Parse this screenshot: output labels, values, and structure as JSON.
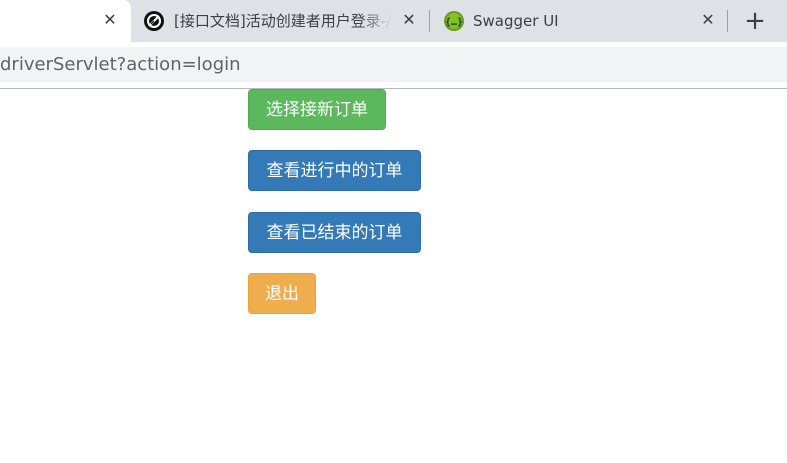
{
  "browser": {
    "tabs": [
      {
        "title": "",
        "close_glyph": "✕",
        "active": true
      },
      {
        "title": "[接口文档]活动创建者用户登录-/",
        "icon": "dial-icon",
        "close_glyph": "✕",
        "active": false
      },
      {
        "title": "Swagger UI",
        "icon": "swagger-icon",
        "icon_color": "#6a9a1f",
        "close_glyph": "✕",
        "active": false
      }
    ],
    "new_tab_glyph": "+",
    "address": "driverServlet?action=login"
  },
  "page": {
    "buttons": [
      {
        "label": "选择接新订单",
        "style": "success",
        "color": "#5cb85c"
      },
      {
        "label": "查看进行中的订单",
        "style": "primary",
        "color": "#337ab7"
      },
      {
        "label": "查看已结束的订单",
        "style": "primary",
        "color": "#337ab7"
      },
      {
        "label": "退出",
        "style": "warning",
        "color": "#f0ad4e"
      }
    ]
  }
}
